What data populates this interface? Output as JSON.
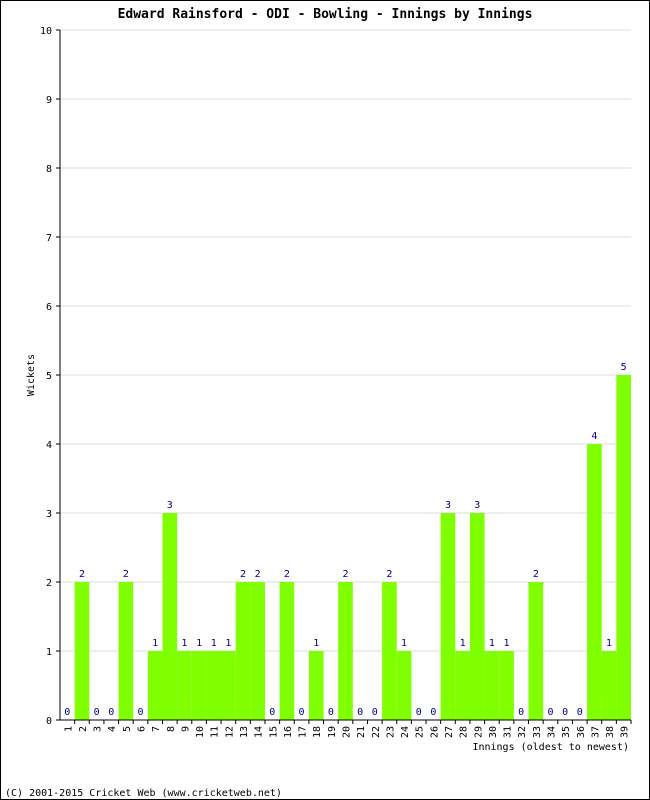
{
  "chart_data": {
    "type": "bar",
    "title": "Edward Rainsford - ODI - Bowling - Innings by Innings",
    "xlabel": "Innings (oldest to newest)",
    "ylabel": "Wickets",
    "ylim": [
      0,
      10
    ],
    "yticks": [
      0,
      1,
      2,
      3,
      4,
      5,
      6,
      7,
      8,
      9,
      10
    ],
    "grid": true,
    "categories": [
      "1",
      "2",
      "3",
      "4",
      "5",
      "6",
      "7",
      "8",
      "9",
      "10",
      "11",
      "12",
      "13",
      "14",
      "15",
      "16",
      "17",
      "18",
      "19",
      "20",
      "21",
      "22",
      "23",
      "24",
      "25",
      "26",
      "27",
      "28",
      "29",
      "30",
      "31",
      "32",
      "33",
      "34",
      "35",
      "36",
      "37",
      "38",
      "39"
    ],
    "values": [
      0,
      2,
      0,
      0,
      2,
      0,
      1,
      3,
      1,
      1,
      1,
      1,
      2,
      2,
      0,
      2,
      0,
      1,
      0,
      2,
      0,
      0,
      2,
      1,
      0,
      0,
      3,
      1,
      3,
      1,
      1,
      0,
      2,
      0,
      0,
      0,
      4,
      1,
      5
    ],
    "colors": {
      "bar": "#80ff00",
      "label": "#000080",
      "grid": "#dddddd"
    }
  },
  "footer": "(C) 2001-2015 Cricket Web (www.cricketweb.net)"
}
